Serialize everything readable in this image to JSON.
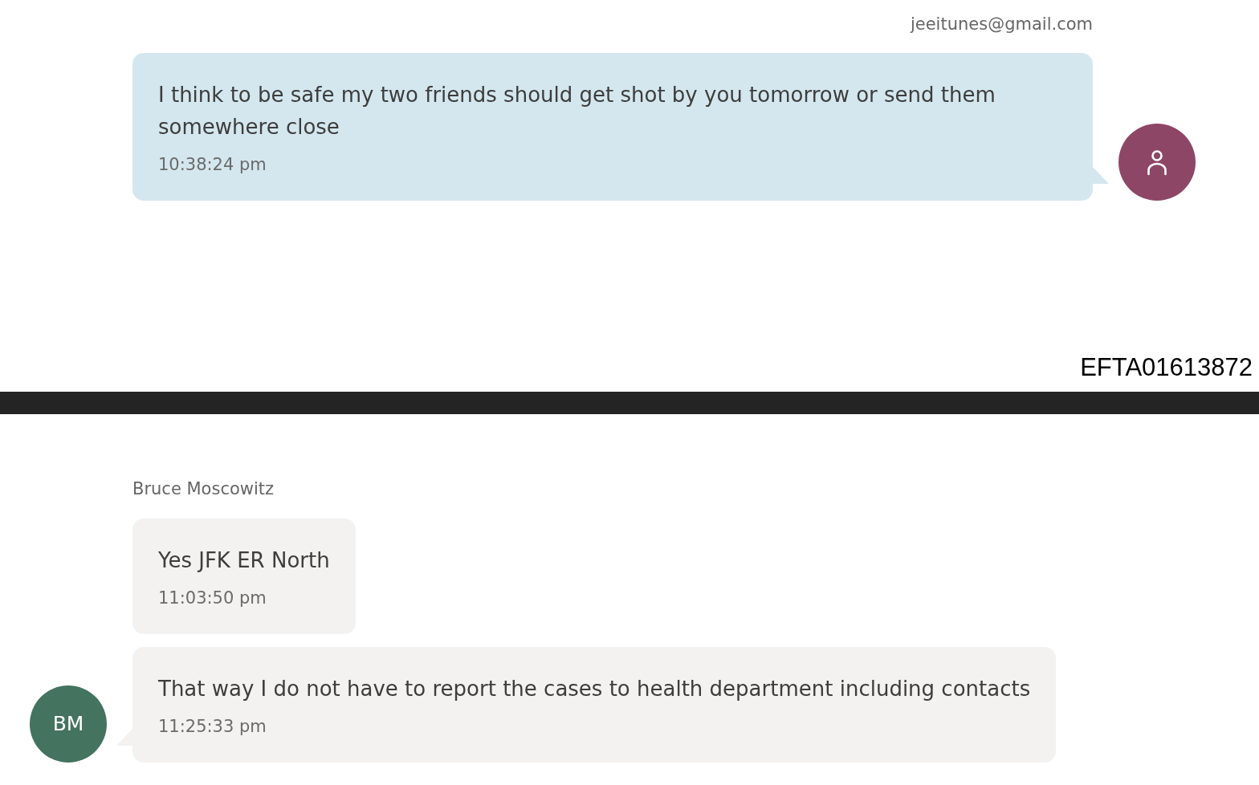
{
  "sections": [
    {
      "groups": [
        {
          "kind": "outgoing",
          "sender": "jeeitunes@gmail.com",
          "avatar": {
            "kind": "icon",
            "color": "#8e4666"
          },
          "messages": [
            {
              "text": "I think to be safe my two friends should get shot by you tomorrow or send them somewhere close",
              "time": "10:38:24 pm"
            }
          ]
        }
      ],
      "stamp": "EFTA01613872"
    },
    {
      "groups": [
        {
          "kind": "incoming",
          "sender": "Bruce Moscowitz",
          "avatar": {
            "kind": "initials",
            "initials": "BM",
            "color": "#44735f"
          },
          "messages": [
            {
              "text": "Yes JFK ER North",
              "time": "11:03:50 pm"
            },
            {
              "text": "That way I do not have to report the cases to health department including contacts",
              "time": "11:25:33 pm"
            }
          ]
        }
      ]
    }
  ]
}
